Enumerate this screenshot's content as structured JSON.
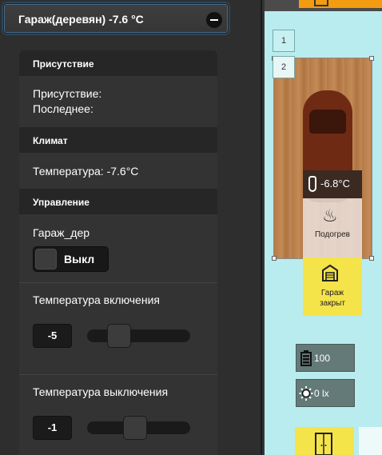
{
  "panel": {
    "title": "Гараж(деревян) -7.6 °C",
    "groups": {
      "presence": {
        "header": "Присутствие",
        "presence_label": "Присутствие:",
        "last_label": "Последнее:"
      },
      "climate": {
        "header": "Климат",
        "temperature_text": "Температура: -7.6°C"
      },
      "control": {
        "header": "Управление",
        "switch_name": "Гараж_дер",
        "switch_state": "Выкл",
        "on_temp": {
          "label": "Температура включения",
          "value": "-5",
          "slider_fraction": 0.25
        },
        "off_temp": {
          "label": "Температура выключения",
          "value": "-1",
          "slider_fraction": 0.45
        }
      }
    }
  },
  "plan": {
    "pages": [
      "1",
      "2"
    ],
    "temperature": "-6.8°C",
    "heating_label": "Подогрев",
    "garage_label": [
      "Гараж",
      "закрыт"
    ],
    "battery_value": "100",
    "lux_value": "0 lx"
  },
  "colors": {
    "accent_yellow": "#f5e34a",
    "accent_orange": "#f39c12",
    "plan_background": "#b9ecee"
  }
}
